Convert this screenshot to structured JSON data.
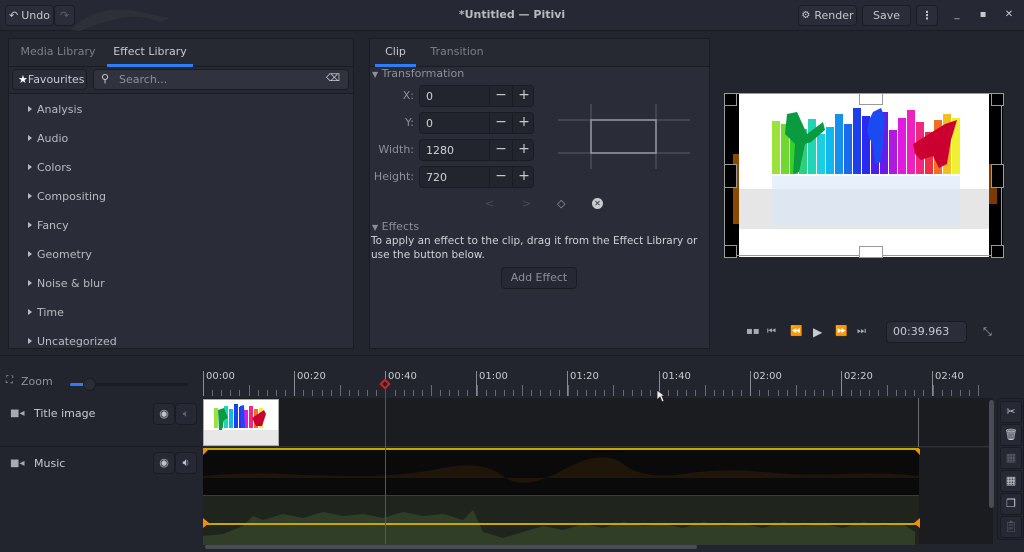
{
  "window": {
    "title": "*Untitled — Pitivi",
    "undo_label": "Undo",
    "redo_icon": "redo-icon",
    "render_label": "Render",
    "save_label": "Save",
    "menu_icon": "vertical-dots-icon",
    "minimize_icon": "minimize-icon",
    "maximize_icon": "maximize-icon",
    "close_icon": "close-icon"
  },
  "library": {
    "tabs": [
      {
        "label": "Media Library",
        "active": false
      },
      {
        "label": "Effect Library",
        "active": true
      }
    ],
    "favourites_label": "Favourites",
    "search": {
      "value": "",
      "placeholder": "Search..."
    },
    "categories": [
      "Analysis",
      "Audio",
      "Colors",
      "Compositing",
      "Fancy",
      "Geometry",
      "Noise & blur",
      "Time",
      "Uncategorized"
    ]
  },
  "clip_panel": {
    "tabs": [
      {
        "label": "Clip",
        "active": true
      },
      {
        "label": "Transition",
        "active": false
      }
    ],
    "transformation_header": "Transformation",
    "fields": [
      {
        "label": "X:",
        "value": "0"
      },
      {
        "label": "Y:",
        "value": "0"
      },
      {
        "label": "Width:",
        "value": "1280"
      },
      {
        "label": "Height:",
        "value": "720"
      }
    ],
    "keyframe_prev": "<",
    "keyframe_next": ">",
    "effects_header": "Effects",
    "effects_help": "To apply an effect to the clip, drag it from the Effect Library or use the button below.",
    "add_effect_label": "Add Effect"
  },
  "viewer": {
    "timecode": "00:39.963"
  },
  "timeline": {
    "zoom_label": "Zoom",
    "zoom_level": 0.16,
    "ruler_labels": [
      "00:00",
      "00:20",
      "00:40",
      "01:00",
      "01:20",
      "01:40",
      "02:00",
      "02:20",
      "02:40"
    ],
    "playhead_time": "00:39.963",
    "layers": [
      {
        "name": "Title image",
        "video_visible": true,
        "audio_enabled": false
      },
      {
        "name": "Music",
        "video_visible": true,
        "audio_enabled": true
      }
    ],
    "side_tools": [
      "cut-icon",
      "delete-icon",
      "ungroup-icon",
      "group-icon",
      "copy-icon",
      "paste-icon"
    ]
  },
  "colors": {
    "accent": "#2f7cf6",
    "playhead": "#d0202a",
    "audio_envelope": "#c8a800",
    "clip_handle": "#ff8a00"
  }
}
